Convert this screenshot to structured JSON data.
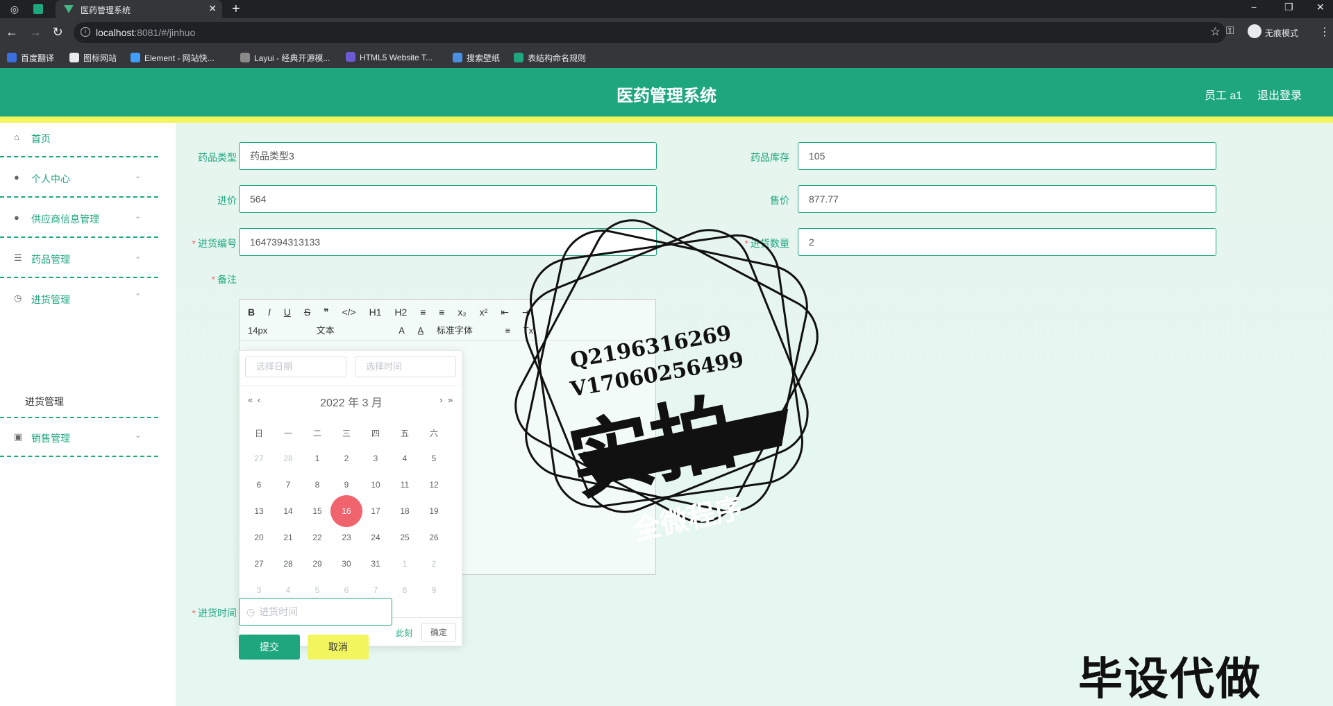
{
  "browser": {
    "tab_title": "医药管理系统",
    "url_host": "localhost",
    "url_rest": ":8081/#/jinhuo",
    "incognito_label": "无痕模式",
    "bookmarks": [
      "百度翻译",
      "图标网站",
      "Element - 网站快...",
      "Layui - 经典开源模...",
      "HTML5 Website T...",
      "搜索壁纸",
      "表结构命名规则"
    ]
  },
  "header": {
    "title": "医药管理系统",
    "user": "员工 a1",
    "logout": "退出登录"
  },
  "sidebar": {
    "items": [
      {
        "label": "首页",
        "icon": "home-icon"
      },
      {
        "label": "个人中心",
        "icon": "user-icon"
      },
      {
        "label": "供应商信息管理",
        "icon": "user-icon"
      },
      {
        "label": "药品管理",
        "icon": "menu-icon"
      },
      {
        "label": "进货管理",
        "icon": "clock-icon"
      },
      {
        "label": "销售管理",
        "icon": "briefcase-icon"
      }
    ],
    "sub_item": "进货管理"
  },
  "form": {
    "drug_type_label": "药品类型",
    "drug_type_value": "药品类型3",
    "stock_label": "药品库存",
    "stock_value": "105",
    "cost_label": "进价",
    "cost_value": "564",
    "price_label": "售价",
    "price_value": "877.77",
    "code_label": "进货编号",
    "code_value": "1647394313133",
    "qty_label": "进货数量",
    "qty_value": "2",
    "remark_label": "备注",
    "time_label": "进货时间",
    "time_placeholder": "进货时间",
    "submit": "提交",
    "cancel": "取消"
  },
  "editor": {
    "toolbar_row1": [
      "B",
      "I",
      "U",
      "S",
      "❞",
      "</>",
      "H1",
      "H2",
      "≡",
      "≡",
      "x₂",
      "x²",
      "⇤",
      "⇥"
    ],
    "size": "14px",
    "style": "文本",
    "font": "标准字体"
  },
  "datepicker": {
    "date_placeholder": "选择日期",
    "time_placeholder": "选择时间",
    "year_month": "2022 年  3 月",
    "weekdays": [
      "日",
      "一",
      "二",
      "三",
      "四",
      "五",
      "六"
    ],
    "weeks": [
      [
        "27",
        "28",
        "1",
        "2",
        "3",
        "4",
        "5"
      ],
      [
        "6",
        "7",
        "8",
        "9",
        "10",
        "11",
        "12"
      ],
      [
        "13",
        "14",
        "15",
        "16",
        "17",
        "18",
        "19"
      ],
      [
        "20",
        "21",
        "22",
        "23",
        "24",
        "25",
        "26"
      ],
      [
        "27",
        "28",
        "29",
        "30",
        "31",
        "1",
        "2"
      ],
      [
        "3",
        "4",
        "5",
        "6",
        "7",
        "8",
        "9"
      ]
    ],
    "muted": [
      [
        0,
        0
      ],
      [
        0,
        1
      ],
      [
        4,
        5
      ],
      [
        4,
        6
      ],
      [
        5,
        0
      ],
      [
        5,
        1
      ],
      [
        5,
        2
      ],
      [
        5,
        3
      ],
      [
        5,
        4
      ],
      [
        5,
        5
      ],
      [
        5,
        6
      ]
    ],
    "selected": [
      2,
      3
    ],
    "now": "此刻",
    "ok": "确定"
  },
  "watermark": {
    "line1": "Q2196316269",
    "line2": "V17060256499",
    "big": "实拍",
    "banner": "全微程序",
    "bottom": "毕设代做"
  },
  "colors": {
    "brand": "#1ea67e",
    "accent_yellow": "#f2f55d",
    "selected_day": "#f0646e"
  }
}
